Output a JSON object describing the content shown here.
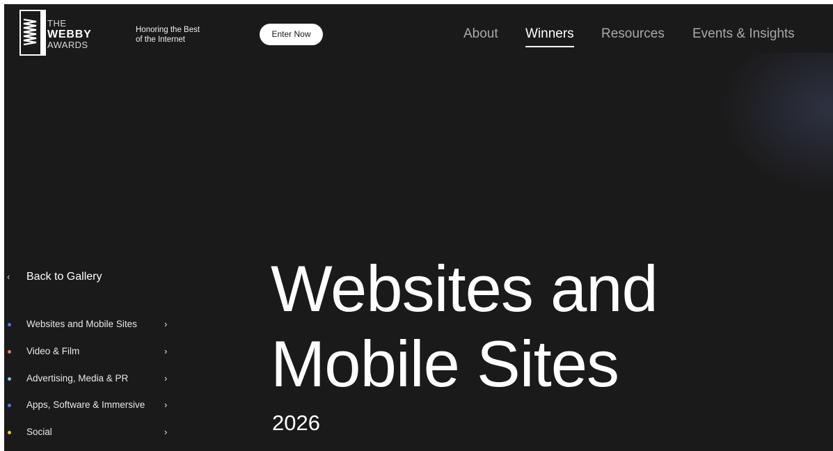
{
  "brand": {
    "logo_line1": "THE",
    "logo_line2": "WEBBY",
    "logo_line3": "AWARDS",
    "tagline_line1": "Honoring the Best",
    "tagline_line2": "of the Internet"
  },
  "header": {
    "enter_label": "Enter Now",
    "nav": [
      {
        "label": "About",
        "active": false
      },
      {
        "label": "Winners",
        "active": true
      },
      {
        "label": "Resources",
        "active": false
      },
      {
        "label": "Events & Insights",
        "active": false
      }
    ]
  },
  "sidebar": {
    "back_label": "Back to Gallery",
    "items": [
      {
        "label": "Websites and Mobile Sites",
        "dot_color": "#4a7cf0"
      },
      {
        "label": "Video & Film",
        "dot_color": "#f07a5a"
      },
      {
        "label": "Advertising, Media & PR",
        "dot_color": "#7fc8e8"
      },
      {
        "label": "Apps, Software & Immersive",
        "dot_color": "#4a7cf0"
      },
      {
        "label": "Social",
        "dot_color": "#f0c040"
      }
    ]
  },
  "hero": {
    "title_line1": "Websites and",
    "title_line2": "Mobile Sites",
    "year": "2026"
  },
  "colors": {
    "background": "#1b1a1b",
    "nav_inactive": "#a9a9a9",
    "nav_active": "#ffffff"
  }
}
